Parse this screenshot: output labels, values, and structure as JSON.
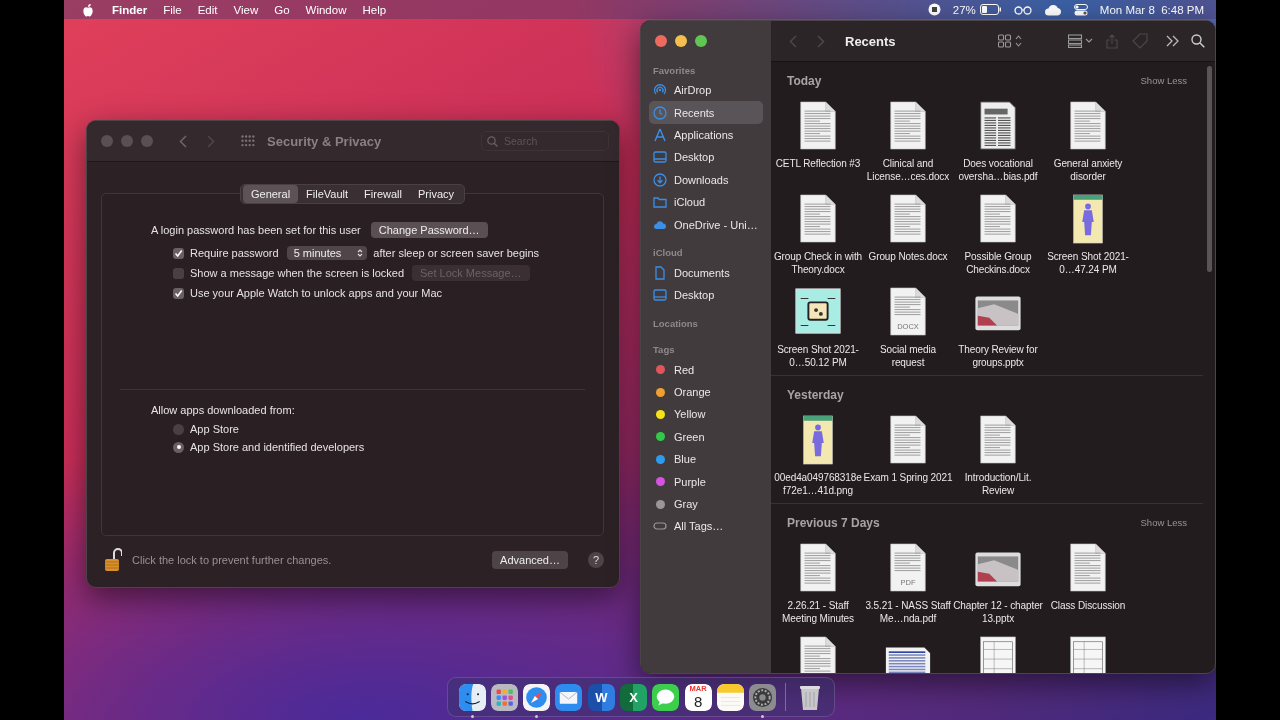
{
  "menu_bar": {
    "app_name": "Finder",
    "menus": [
      "File",
      "Edit",
      "View",
      "Go",
      "Window",
      "Help"
    ],
    "battery_percent": "27%",
    "clock": "Mon Mar 8  6:48 PM"
  },
  "security_window": {
    "title": "Security & Privacy",
    "search": {
      "placeholder": "Search"
    },
    "tabs": [
      {
        "label": "General",
        "selected": true
      },
      {
        "label": "FileVault",
        "selected": false
      },
      {
        "label": "Firewall",
        "selected": false
      },
      {
        "label": "Privacy",
        "selected": false
      }
    ],
    "login_text": "A login password has been set for this user",
    "change_password_button": "Change Password…",
    "options": [
      {
        "label": "Require password",
        "checked": true,
        "delay": "5 minutes",
        "suffix": "after sleep or screen saver begins"
      },
      {
        "label": "Show a message when the screen is locked",
        "checked": false,
        "button": "Set Lock Message…",
        "button_disabled": true
      },
      {
        "label": "Use your Apple Watch to unlock apps and your Mac",
        "checked": true
      }
    ],
    "allow_label": "Allow apps downloaded from:",
    "sources": [
      {
        "label": "App Store",
        "selected": false
      },
      {
        "label": "App Store and identified developers",
        "selected": true
      }
    ],
    "lock": {
      "locked": false,
      "text": "Click the lock to prevent further changes."
    },
    "advanced_button": "Advanced…",
    "help_button": "?"
  },
  "finder_window": {
    "title": "Recents",
    "sidebar": [
      {
        "heading": "Favorites",
        "items": [
          {
            "label": "AirDrop",
            "kind": "airdrop",
            "selected": false
          },
          {
            "label": "Recents",
            "kind": "clock",
            "selected": true
          },
          {
            "label": "Applications",
            "kind": "apps",
            "selected": false
          },
          {
            "label": "Desktop",
            "kind": "desktop",
            "selected": false
          },
          {
            "label": "Downloads",
            "kind": "download",
            "selected": false
          },
          {
            "label": "iCloud",
            "kind": "folder",
            "selected": false
          },
          {
            "label": "OneDrive - Uni…",
            "kind": "cloud",
            "selected": false
          }
        ]
      },
      {
        "heading": "iCloud",
        "items": [
          {
            "label": "Documents",
            "kind": "document",
            "selected": false
          },
          {
            "label": "Desktop",
            "kind": "desktop",
            "selected": false
          }
        ]
      },
      {
        "heading": "Locations"
      },
      {
        "heading": "Tags",
        "items": [
          {
            "label": "Red",
            "kind": "tag",
            "color": "#e0565b",
            "selected": false
          },
          {
            "label": "Orange",
            "kind": "tag",
            "color": "#f0a030",
            "selected": false
          },
          {
            "label": "Yellow",
            "kind": "tag",
            "color": "#f4e318",
            "selected": false
          },
          {
            "label": "Green",
            "kind": "tag",
            "color": "#34c84a",
            "selected": false
          },
          {
            "label": "Blue",
            "kind": "tag",
            "color": "#2c9cf0",
            "selected": false
          },
          {
            "label": "Purple",
            "kind": "tag",
            "color": "#d652e0",
            "selected": false
          },
          {
            "label": "Gray",
            "kind": "tag",
            "color": "#9a9698",
            "selected": false
          },
          {
            "label": "All Tags…",
            "kind": "all-tags",
            "selected": false
          }
        ]
      }
    ],
    "sections": [
      {
        "title": "Today",
        "action": "Show Less",
        "files": [
          {
            "name": "CETL Reflection #3",
            "kind": "doc"
          },
          {
            "name": "Clinical and License…ces.docx",
            "kind": "doc"
          },
          {
            "name": "Does vocational oversha…bias.pdf",
            "kind": "scan"
          },
          {
            "name": "General anxiety disorder",
            "kind": "doc"
          },
          {
            "name": "Group Check in with Theory.docx",
            "kind": "doc"
          },
          {
            "name": "Group Notes.docx",
            "kind": "doc"
          },
          {
            "name": "Possible Group Checkins.docx",
            "kind": "doc"
          },
          {
            "name": "Screen Shot 2021-0…47.24 PM",
            "kind": "figure"
          },
          {
            "name": "Screen Shot 2021-0…50.12 PM",
            "kind": "diagram"
          },
          {
            "name": "Social media request",
            "kind": "doc",
            "badge": "DOCX"
          },
          {
            "name": "Theory Review for groups.pptx",
            "kind": "slide"
          }
        ]
      },
      {
        "title": "Yesterday",
        "files": [
          {
            "name": "00ed4a049768318ef72e1…41d.png",
            "kind": "figure"
          },
          {
            "name": "Exam 1 Spring 2021",
            "kind": "doc"
          },
          {
            "name": "Introduction/Lit. Review",
            "kind": "doc"
          }
        ]
      },
      {
        "title": "Previous 7 Days",
        "action": "Show Less",
        "files": [
          {
            "name": "2.26.21 - Staff Meeting Minutes",
            "kind": "doc"
          },
          {
            "name": "3.5.21 - NASS Staff Me…nda.pdf",
            "kind": "doc",
            "badge": "PDF"
          },
          {
            "name": "Chapter 12 - chapter 13.pptx",
            "kind": "slide"
          },
          {
            "name": "Class Discussion",
            "kind": "doc"
          },
          {
            "kind": "doc"
          },
          {
            "kind": "table"
          },
          {
            "kind": "form"
          },
          {
            "kind": "form"
          }
        ]
      }
    ]
  },
  "dock": {
    "apps": [
      {
        "kind": "finder",
        "running": true
      },
      {
        "kind": "launchpad",
        "running": false
      },
      {
        "kind": "safari",
        "running": true
      },
      {
        "kind": "mail",
        "running": false
      },
      {
        "kind": "word",
        "letter": "W",
        "running": false
      },
      {
        "kind": "excel",
        "letter": "X",
        "running": false
      },
      {
        "kind": "messages",
        "running": false
      },
      {
        "kind": "calendar",
        "month": "MAR",
        "day": "8",
        "running": false
      },
      {
        "kind": "notes",
        "running": false
      },
      {
        "kind": "settings",
        "running": true
      }
    ],
    "trash": {
      "running": false
    }
  }
}
